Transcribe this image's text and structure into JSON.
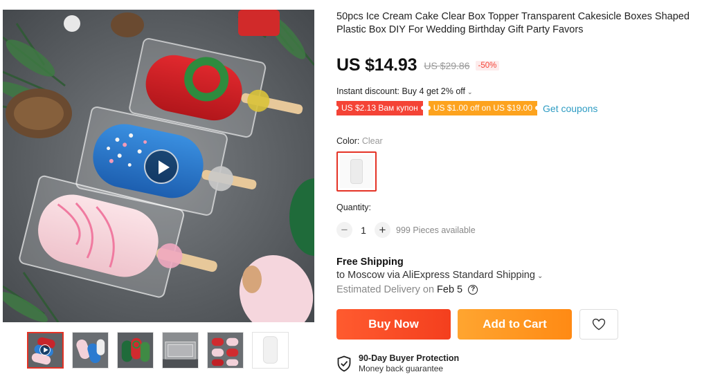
{
  "product": {
    "title": "50pcs Ice Cream Cake Clear Box Topper Transparent Cakesicle Boxes Shaped Plastic Box DIY For Wedding Birthday Gift Party Favors",
    "price": "US $14.93",
    "old_price": "US $29.86",
    "discount": "-50%"
  },
  "promo": {
    "instant_discount": "Instant discount: Buy 4 get 2% off",
    "chevron": "⌄",
    "coupons": [
      "US $2.13 Вам купон",
      "US $1.00 off on US $19.00"
    ],
    "get_coupons": "Get coupons"
  },
  "variant": {
    "label": "Color: ",
    "value": "Clear"
  },
  "quantity": {
    "label": "Quantity:",
    "minus": "−",
    "plus": "+",
    "value": "1",
    "available": "999 Pieces available"
  },
  "shipping": {
    "title": "Free Shipping",
    "destination": "to Moscow via AliExpress Standard Shipping",
    "chevron": "⌄",
    "estimate_label": "Estimated Delivery on",
    "estimate_date": "Feb 5",
    "help": "?"
  },
  "actions": {
    "buy_now": "Buy Now",
    "add_to_cart": "Add to Cart",
    "wishlist_icon": "heart-icon"
  },
  "protection": {
    "title": "90-Day Buyer Protection",
    "subtitle": "Money back guarantee",
    "icon": "shield-check-icon"
  },
  "gallery": {
    "thumbnail_count": 6,
    "active_index": 0,
    "has_video": true
  },
  "colors": {
    "accent_red": "#e43225",
    "coupon_red": "#f44336",
    "coupon_orange": "#fda31e",
    "link_blue": "#2e9cc3",
    "buy_now": "#f9471f",
    "add_to_cart": "#ff9a1e"
  }
}
